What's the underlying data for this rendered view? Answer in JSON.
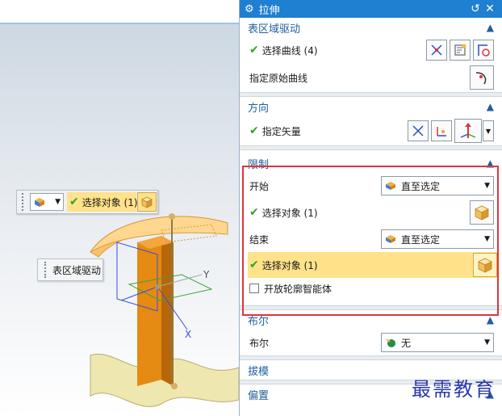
{
  "viewport": {
    "float_toolbar": {
      "selection_label": "选择对象 (1)"
    },
    "surface_label": "表区域驱动",
    "axis_y": "Y",
    "axis_x": "X"
  },
  "dialog": {
    "title": "拉伸",
    "sections": {
      "surface_drive": {
        "heading": "表区域驱动",
        "select_curve": "选择曲线 (4)",
        "specify_original": "指定原始曲线"
      },
      "direction": {
        "heading": "方向",
        "specify_vector": "指定矢量"
      },
      "limits": {
        "heading": "限制",
        "start_label": "开始",
        "start_value": "直至选定",
        "start_select": "选择对象 (1)",
        "end_label": "结束",
        "end_value": "直至选定",
        "end_select": "选择对象 (1)",
        "open_profile": "开放轮廓智能体"
      },
      "boolean": {
        "heading": "布尔",
        "label": "布尔",
        "value": "无"
      },
      "draft": {
        "heading": "拔模"
      },
      "offset": {
        "heading": "偏置"
      }
    }
  },
  "watermark": "最需教育",
  "colors": {
    "titlebar": "#1f7fd0",
    "highlight": "#ffe28a",
    "limit_border": "#e0343b",
    "section_heading": "#1f5f9f"
  }
}
